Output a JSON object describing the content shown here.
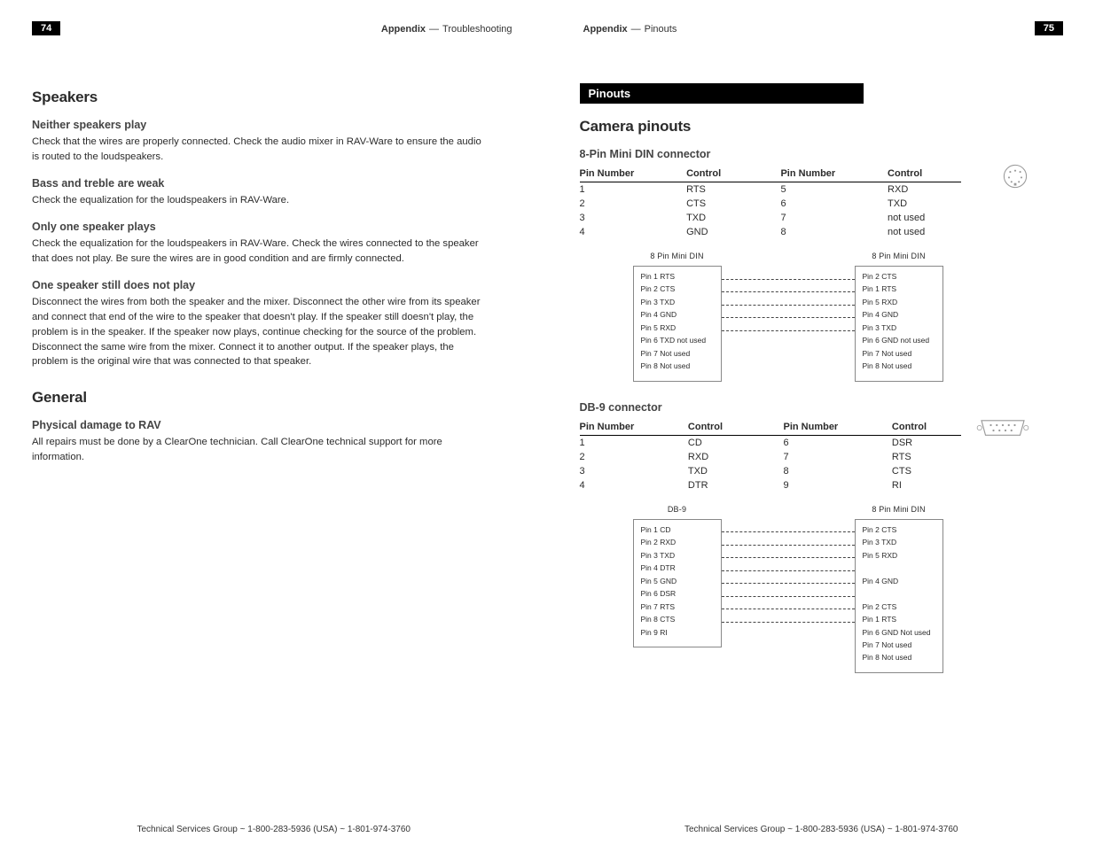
{
  "pageLeft": {
    "pageNumber": "74",
    "runningHead": {
      "section": "Appendix",
      "sub": "Troubleshooting"
    },
    "h_speakers": "Speakers",
    "su1_h": "Neither speakers play",
    "su1_p": "Check that the wires are properly connected. Check the audio mixer in RAV-Ware to ensure the audio is routed to the loudspeakers.",
    "su2_h": "Bass and treble are weak",
    "su2_p": "Check the equalization for the loudspeakers in RAV-Ware.",
    "su3_h": "Only one speaker plays",
    "su3_p": "Check the equalization for the loudspeakers in RAV-Ware. Check the wires connected to the speaker that does not play. Be sure the wires are in good condition and are firmly connected.",
    "su4_h": "One speaker still does not play",
    "su4_p": "Disconnect the wires from both the speaker and the mixer. Disconnect the other wire from its speaker and connect that end of the wire to the speaker that doesn't play. If the speaker still doesn't play, the problem is in the speaker. If the speaker now plays, continue checking for the source of the problem. Disconnect the same wire from the mixer. Connect it to another output. If the speaker plays, the problem is the original wire that was connected to that speaker.",
    "h_general": "General",
    "gu1_h": "Physical damage to RAV",
    "gu1_p": "All repairs must be done by a ClearOne technician. Call ClearOne technical support for more information.",
    "footer": "Technical Services Group ~ 1-800-283-5936 (USA) ~ 1-801-974-3760"
  },
  "pageRight": {
    "pageNumber": "75",
    "runningHead": {
      "section": "Appendix",
      "sub": "Pinouts"
    },
    "tab": "Pinouts",
    "h_camera": "Camera pinouts",
    "h_8pin": "8-Pin Mini DIN connector",
    "tableHead": {
      "pin": "Pin Number",
      "ctrl": "Control"
    },
    "din_table": [
      {
        "a_pin": "1",
        "a_ctrl": "RTS",
        "b_pin": "5",
        "b_ctrl": "RXD"
      },
      {
        "a_pin": "2",
        "a_ctrl": "CTS",
        "b_pin": "6",
        "b_ctrl": "TXD"
      },
      {
        "a_pin": "3",
        "a_ctrl": "TXD",
        "b_pin": "7",
        "b_ctrl": "not used"
      },
      {
        "a_pin": "4",
        "a_ctrl": "GND",
        "b_pin": "8",
        "b_ctrl": "not used"
      }
    ],
    "din_wiring": {
      "leftTitle": "8 Pin Mini DIN",
      "rightTitle": "8 Pin Mini DIN",
      "left": [
        "Pin 1 RTS",
        "Pin 2 CTS",
        "Pin 3 TXD",
        "Pin 4 GND",
        "Pin 5 RXD",
        "Pin 6 TXD not used",
        "Pin 7 Not used",
        "Pin 8 Not used"
      ],
      "right": [
        "Pin 2 CTS",
        "Pin 1 RTS",
        "Pin 5 RXD",
        "Pin 4 GND",
        "Pin 3 TXD",
        "Pin 6 GND not used",
        "Pin 7 Not used",
        "Pin 8 Not used"
      ],
      "lines": [
        true,
        true,
        true,
        true,
        true,
        false,
        false,
        false
      ]
    },
    "h_db9": "DB-9 connector",
    "db9_table": [
      {
        "a_pin": "1",
        "a_ctrl": "CD",
        "b_pin": "6",
        "b_ctrl": "DSR"
      },
      {
        "a_pin": "2",
        "a_ctrl": "RXD",
        "b_pin": "7",
        "b_ctrl": "RTS"
      },
      {
        "a_pin": "3",
        "a_ctrl": "TXD",
        "b_pin": "8",
        "b_ctrl": "CTS"
      },
      {
        "a_pin": "4",
        "a_ctrl": "DTR",
        "b_pin": "9",
        "b_ctrl": "RI"
      }
    ],
    "db9_wiring": {
      "leftTitle": "DB-9",
      "rightTitle": "8 Pin Mini DIN",
      "left": [
        "Pin 1 CD",
        "Pin 2 RXD",
        "Pin 3 TXD",
        "Pin 4 DTR",
        "Pin 5 GND",
        "Pin 6 DSR",
        "Pin 7 RTS",
        "Pin 8 CTS",
        "Pin 9 RI"
      ],
      "right": [
        "Pin 2 CTS",
        "Pin 3 TXD",
        "Pin 5 RXD",
        "",
        "Pin 4 GND",
        "",
        "Pin 2 CTS",
        "Pin 1 RTS",
        "Pin 6 GND Not used",
        "Pin 7 Not used",
        "Pin 8 Not used"
      ],
      "lines": [
        true,
        true,
        true,
        true,
        true,
        true,
        true,
        true,
        false
      ]
    },
    "footer": "Technical Services Group ~ 1-800-283-5936 (USA) ~ 1-801-974-3760"
  }
}
